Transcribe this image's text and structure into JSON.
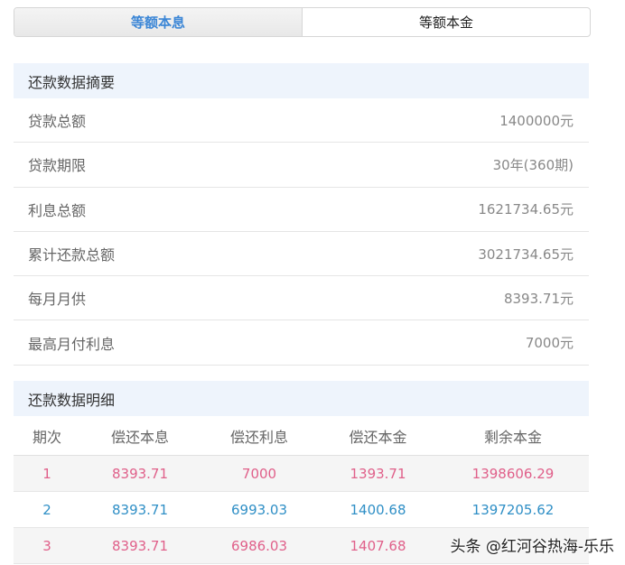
{
  "tabs": {
    "equal_installment": "等额本息",
    "equal_principal": "等额本金"
  },
  "summary": {
    "title": "还款数据摘要",
    "rows": [
      {
        "label": "贷款总额",
        "value": "1400000元"
      },
      {
        "label": "贷款期限",
        "value": "30年(360期)"
      },
      {
        "label": "利息总额",
        "value": "1621734.65元"
      },
      {
        "label": "累计还款总额",
        "value": "3021734.65元"
      },
      {
        "label": "每月月供",
        "value": "8393.71元"
      },
      {
        "label": "最高月付利息",
        "value": "7000元"
      }
    ]
  },
  "detail": {
    "title": "还款数据明细",
    "headers": [
      "期次",
      "偿还本息",
      "偿还利息",
      "偿还本金",
      "剩余本金"
    ],
    "rows": [
      [
        "1",
        "8393.71",
        "7000",
        "1393.71",
        "1398606.29"
      ],
      [
        "2",
        "8393.71",
        "6993.03",
        "1400.68",
        "1397205.62"
      ],
      [
        "3",
        "8393.71",
        "6986.03",
        "1407.68",
        ""
      ]
    ]
  },
  "watermark": "头条 @红河谷热海-乐乐",
  "colors": {
    "accent": "#3b86d6",
    "row_pink": "#e0608a",
    "row_blue": "#2f8fc6",
    "section_bg": "#eef4fc"
  }
}
